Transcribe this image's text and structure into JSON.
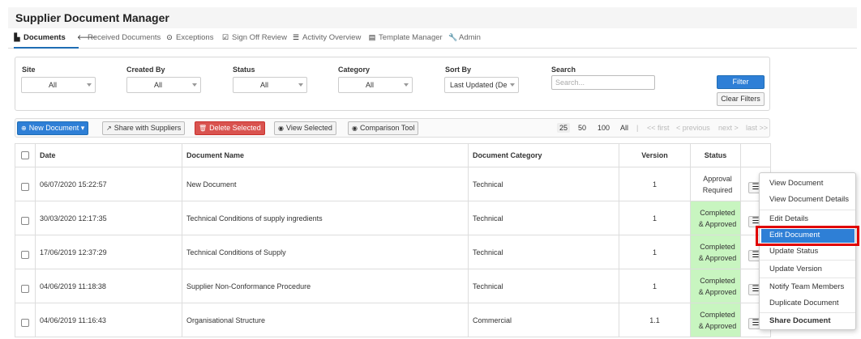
{
  "app": {
    "title": "Supplier Document Manager"
  },
  "nav": [
    {
      "icon": "document-icon",
      "glyph": "▙",
      "label": "Documents",
      "active": true
    },
    {
      "icon": "arrow-left-icon",
      "glyph": "🡐",
      "label": "Received Documents"
    },
    {
      "icon": "exclamation-circle-icon",
      "glyph": "⊙",
      "label": "Exceptions"
    },
    {
      "icon": "check-square-icon",
      "glyph": "☑",
      "label": "Sign Off Review"
    },
    {
      "icon": "list-icon",
      "glyph": "☰",
      "label": "Activity Overview"
    },
    {
      "icon": "template-icon",
      "glyph": "▤",
      "label": "Template Manager"
    },
    {
      "icon": "wrench-icon",
      "glyph": "🔧",
      "label": "Admin"
    }
  ],
  "filters": {
    "site": {
      "label": "Site",
      "value": "All"
    },
    "created_by": {
      "label": "Created By",
      "value": "All"
    },
    "status": {
      "label": "Status",
      "value": "All"
    },
    "category": {
      "label": "Category",
      "value": "All"
    },
    "sort_by": {
      "label": "Sort By",
      "value": "Last Updated (Desc"
    },
    "search": {
      "label": "Search",
      "placeholder": "Search..."
    },
    "filter_button": "Filter",
    "clear_button": "Clear Filters"
  },
  "toolbar": {
    "new_document": "New Document",
    "share": "Share with Suppliers",
    "delete": "Delete Selected",
    "view_selected": "View Selected",
    "comparison": "Comparison Tool",
    "page_sizes": [
      "25",
      "50",
      "100",
      "All"
    ],
    "page_size_selected": "25",
    "separator": "|",
    "first": "<< first",
    "previous": "< previous",
    "next": "next >",
    "last": "last >>"
  },
  "table": {
    "headers": [
      "Date",
      "Document Name",
      "Document Category",
      "Version",
      "Status"
    ],
    "rows": [
      {
        "date": "06/07/2020 15:22:57",
        "name": "New Document",
        "category": "Technical",
        "version": "1",
        "status_line1": "Approval",
        "status_line2": "Required",
        "approved": false
      },
      {
        "date": "30/03/2020 12:17:35",
        "name": "Technical Conditions of supply ingredients",
        "category": "Technical",
        "version": "1",
        "status_line1": "Completed",
        "status_line2": "& Approved",
        "approved": true
      },
      {
        "date": "17/06/2019 12:37:29",
        "name": "Technical Conditions of Supply",
        "category": "Technical",
        "version": "1",
        "status_line1": "Completed",
        "status_line2": "& Approved",
        "approved": true
      },
      {
        "date": "04/06/2019 11:18:38",
        "name": "Supplier Non-Conformance Procedure",
        "category": "Technical",
        "version": "1",
        "status_line1": "Completed",
        "status_line2": "& Approved",
        "approved": true
      },
      {
        "date": "04/06/2019 11:16:43",
        "name": "Organisational Structure",
        "category": "Commercial",
        "version": "1.1",
        "status_line1": "Completed",
        "status_line2": "& Approved",
        "approved": true
      }
    ]
  },
  "row_menu": {
    "items": [
      "View Document",
      "View Document Details",
      "Edit Details",
      "Edit Document",
      "Update Status",
      "Update Version",
      "Notify Team Members",
      "Duplicate Document",
      "Share Document"
    ],
    "highlighted": "Edit Document"
  },
  "colors": {
    "accent": "#2e7fd6",
    "danger": "#d9534f",
    "approved_bg": "#c8f5c0",
    "highlight_box": "#e00000"
  }
}
